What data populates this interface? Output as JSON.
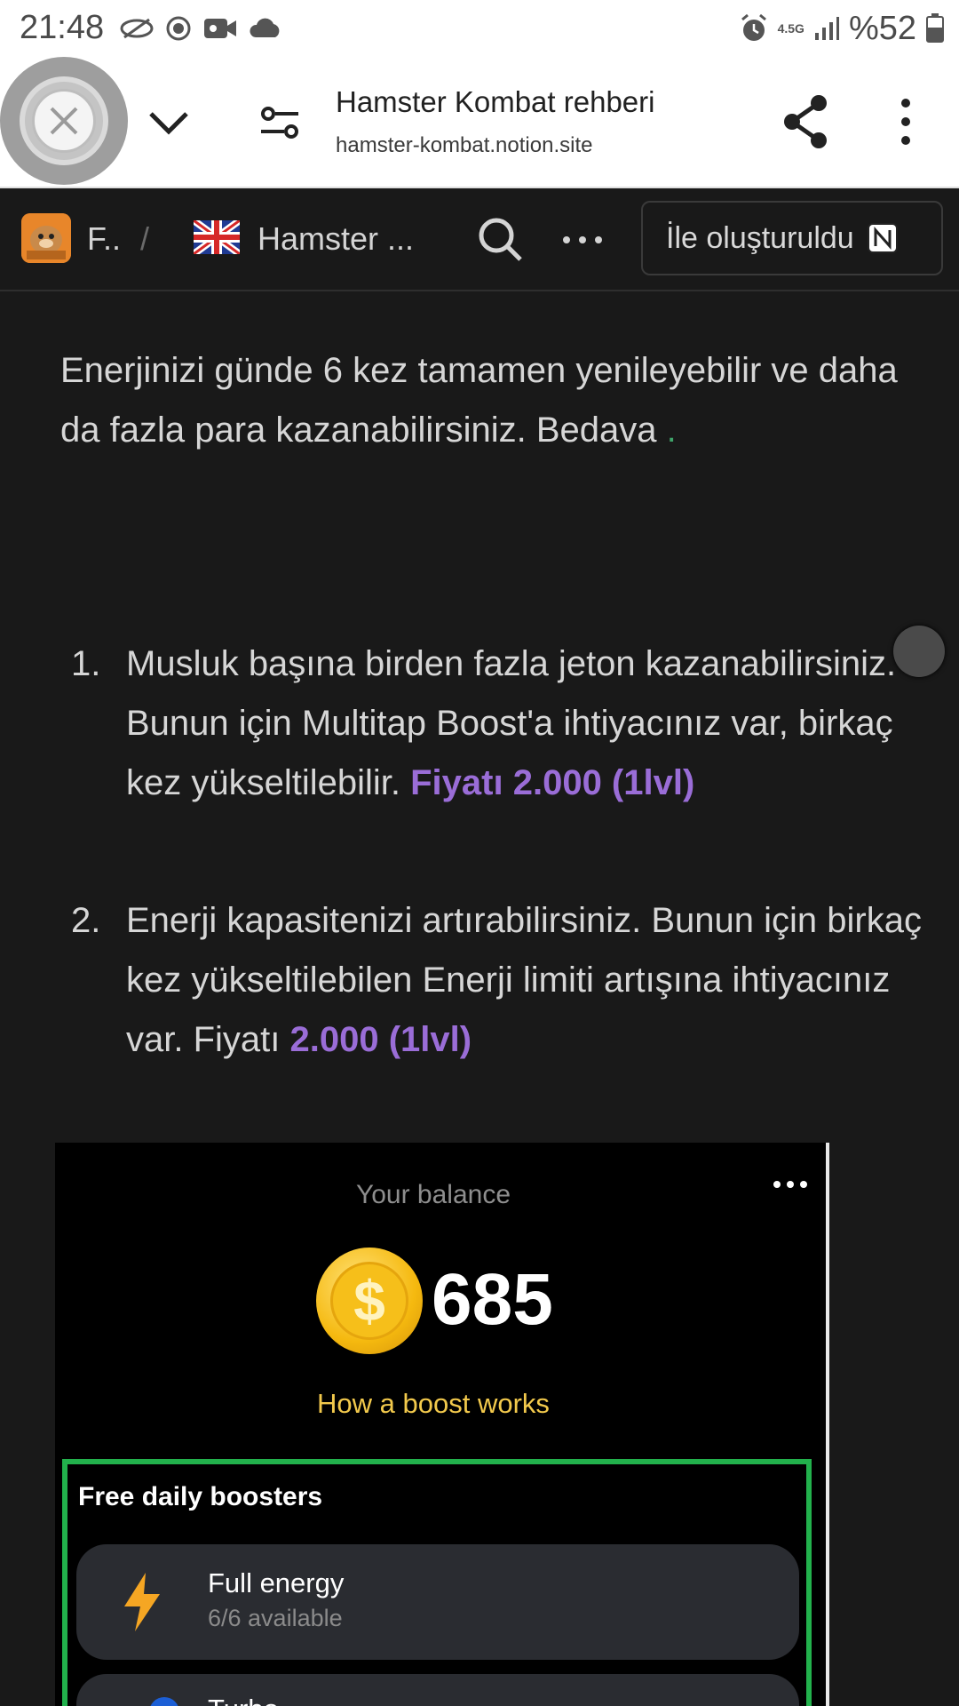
{
  "status_bar": {
    "time": "21:48",
    "network": "4.5G",
    "battery": "%52"
  },
  "browser": {
    "title": "Hamster Kombat rehberi",
    "url": "hamster-kombat.notion.site"
  },
  "notion_header": {
    "breadcrumb_1": "F..",
    "separator": "/",
    "breadcrumb_2": "Hamster ...",
    "made_with": "İle oluşturuldu"
  },
  "content": {
    "paragraph_1": "Enerjinizi günde 6 kez tamamen yenileyebilir ve daha da fazla para kazanabilirsiniz. Bedava",
    "paragraph_1_dot": ".",
    "list": [
      {
        "number": "1.",
        "text": "Musluk başına birden fazla jeton kazanabilirsiniz. Bunun için Multitap Boost'a ihtiyacınız var, birkaç kez yükseltilebilir. ",
        "highlight": "Fiyatı 2.000 (1lvl)"
      },
      {
        "number": "2.",
        "text": "Enerji kapasitenizi artırabilirsiniz. Bunun için birkaç kez yükseltilebilen Enerji limiti artışına ihtiyacınız var. Fiyatı ",
        "highlight": "2.000 (1lvl)"
      }
    ]
  },
  "embed": {
    "balance_label": "Your balance",
    "balance_value": "685",
    "coin_symbol": "$",
    "how_boost": "How a boost works",
    "boosters_title": "Free daily boosters",
    "booster_1_name": "Full energy",
    "booster_1_avail": "6/6 available",
    "booster_2_name": "Turbo"
  },
  "colors": {
    "background": "#191919",
    "accent_purple": "#9a6dd7",
    "booster_border": "#22b14c",
    "boost_link": "#f2c94c"
  }
}
